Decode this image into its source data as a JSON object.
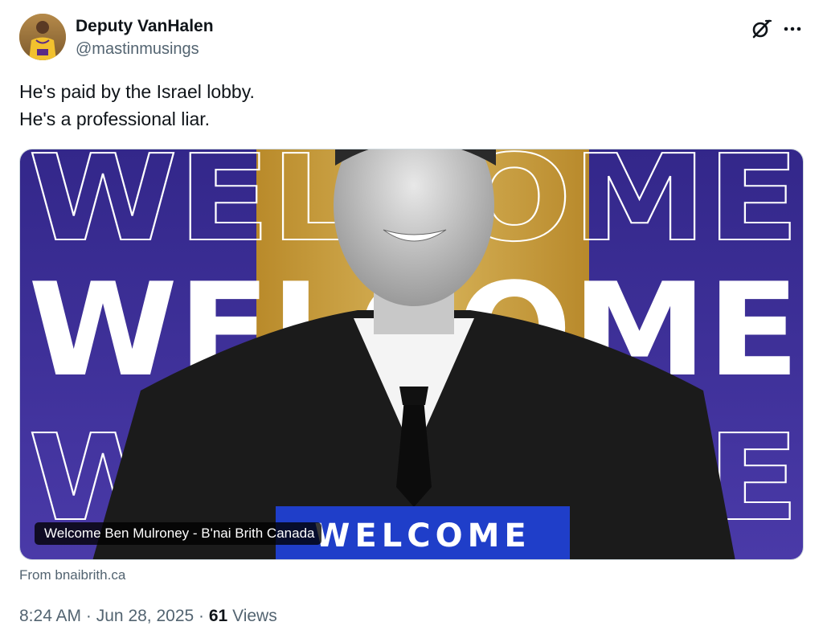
{
  "author": {
    "display_name": "Deputy VanHalen",
    "handle": "@mastinmusings",
    "avatar_icon": "player-in-lakers-jersey-avatar"
  },
  "actions": {
    "grok_icon": "grok-icon",
    "more_icon": "more-horizontal-icon"
  },
  "tweet": {
    "lines": [
      "He's paid by the Israel lobby.",
      "He's a professional liar."
    ]
  },
  "card": {
    "title": "Welcome Ben Mulroney - B'nai Brith Canada",
    "banner_text": "WELCOME",
    "background_word": "WELCOME",
    "source": "From bnaibrith.ca",
    "colors": {
      "purple": "#3a2a8f",
      "gold": "#c59a33",
      "blue_banner": "#1f3ec9"
    }
  },
  "meta": {
    "time": "8:24 AM",
    "separator": "·",
    "date": "Jun 28, 2025",
    "views_count": "61",
    "views_label": "Views"
  }
}
